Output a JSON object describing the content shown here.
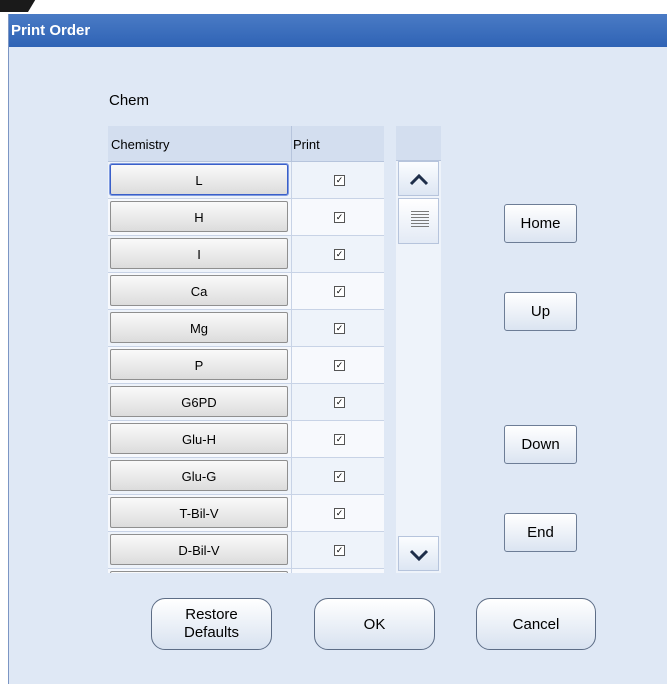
{
  "window": {
    "title": "Print Order"
  },
  "section_label": "Chem",
  "grid": {
    "headers": {
      "chemistry": "Chemistry",
      "print": "Print"
    },
    "rows": [
      {
        "chemistry": "L",
        "print_checked": true
      },
      {
        "chemistry": "H",
        "print_checked": true
      },
      {
        "chemistry": "I",
        "print_checked": true
      },
      {
        "chemistry": "Ca",
        "print_checked": true
      },
      {
        "chemistry": "Mg",
        "print_checked": true
      },
      {
        "chemistry": "P",
        "print_checked": true
      },
      {
        "chemistry": "G6PD",
        "print_checked": true
      },
      {
        "chemistry": "Glu-H",
        "print_checked": true
      },
      {
        "chemistry": "Glu-G",
        "print_checked": true
      },
      {
        "chemistry": "T-Bil-V",
        "print_checked": true
      },
      {
        "chemistry": "D-Bil-V",
        "print_checked": true
      },
      {
        "chemistry": "",
        "print_checked": false
      }
    ],
    "selected_row": 0,
    "scroll_icons": {
      "up": "chevron-up-icon",
      "thumb": "grip-icon",
      "down": "chevron-down-icon"
    }
  },
  "nav_buttons": {
    "home": "Home",
    "up": "Up",
    "down": "Down",
    "end": "End"
  },
  "footer_buttons": {
    "restore_line1": "Restore",
    "restore_line2": "Defaults",
    "ok": "OK",
    "cancel": "Cancel"
  },
  "colors": {
    "title_bar": "#2f63b5",
    "dialog_bg": "#dfe8f5",
    "selection": "#3a5fc9"
  }
}
